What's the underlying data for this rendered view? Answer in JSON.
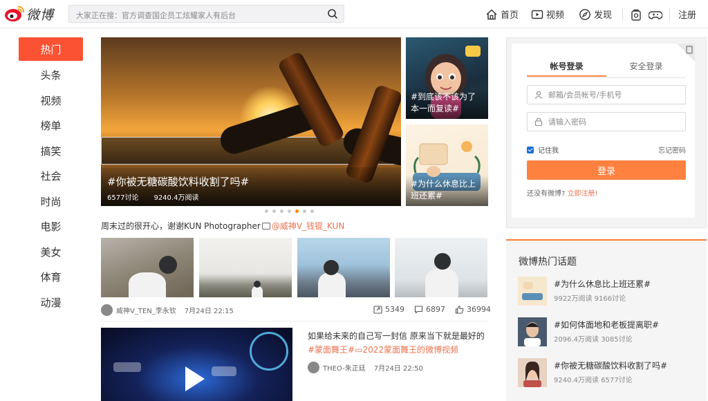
{
  "brand": {
    "name": "微博",
    "accent": "#fa5233",
    "orange": "#ff8140",
    "link_color": "#eb7350"
  },
  "search": {
    "placeholder": "大家正在搜：官方调查国企员工炫耀家人有后台",
    "icon": "search-icon"
  },
  "topnav": {
    "home": "首页",
    "video": "视频",
    "discover": "发现",
    "game_icon": "game-icon",
    "bag_icon": "bag-icon",
    "register": "注册"
  },
  "leftnav": {
    "items": [
      "热门",
      "头条",
      "视频",
      "榜单",
      "搞笑",
      "社会",
      "时尚",
      "电影",
      "美女",
      "体育",
      "动漫"
    ],
    "active_index": 0
  },
  "hero": {
    "title": "#你被无糖碳酸饮料收割了吗#",
    "discussions": "6577讨论",
    "reads": "9240.4万阅读"
  },
  "side_thumbs": [
    {
      "caption": "#到底该不该为了本一而复读#",
      "badge": "好呀!"
    },
    {
      "caption": "#为什么休息比上班还累#"
    }
  ],
  "carousel": {
    "count": 7,
    "active": 4
  },
  "post": {
    "text": "周末过的很开心，谢谢KUN Photographer",
    "mention": "@威神V_钱锟_KUN",
    "author": "威神V_TEN_李永钦",
    "time": "7月24日 22:15",
    "reposts": "5349",
    "comments": "6897",
    "likes": "36994"
  },
  "video_post": {
    "text": "如果给未来的自己写一封信 原来当下就是最好的",
    "tag1": "#蒙面舞王#",
    "tag2_icon": "video-icon",
    "tag2": "2022蒙面舞王的微博视频",
    "author": "THEO-朱正廷",
    "time": "7月24日 22:50"
  },
  "login": {
    "tab_account": "帐号登录",
    "tab_secure": "安全登录",
    "username_placeholder": "邮箱/会员帐号/手机号",
    "password_placeholder": "请输入密码",
    "remember": "记住我",
    "forgot": "忘记密码",
    "login_button": "登录",
    "no_account": "还没有微博?",
    "register_now": "立即注册!"
  },
  "hot_topics": {
    "title": "微博热门话题",
    "items": [
      {
        "title": "#为什么休息比上班还累#",
        "reads": "9922万阅读",
        "discussions": "9166讨论"
      },
      {
        "title": "#如何体面地和老板提离职#",
        "reads": "2096.4万阅读",
        "discussions": "3085讨论"
      },
      {
        "title": "#你被无糖碳酸饮料收割了吗#",
        "reads": "9240.4万阅读",
        "discussions": "6577讨论"
      }
    ]
  }
}
